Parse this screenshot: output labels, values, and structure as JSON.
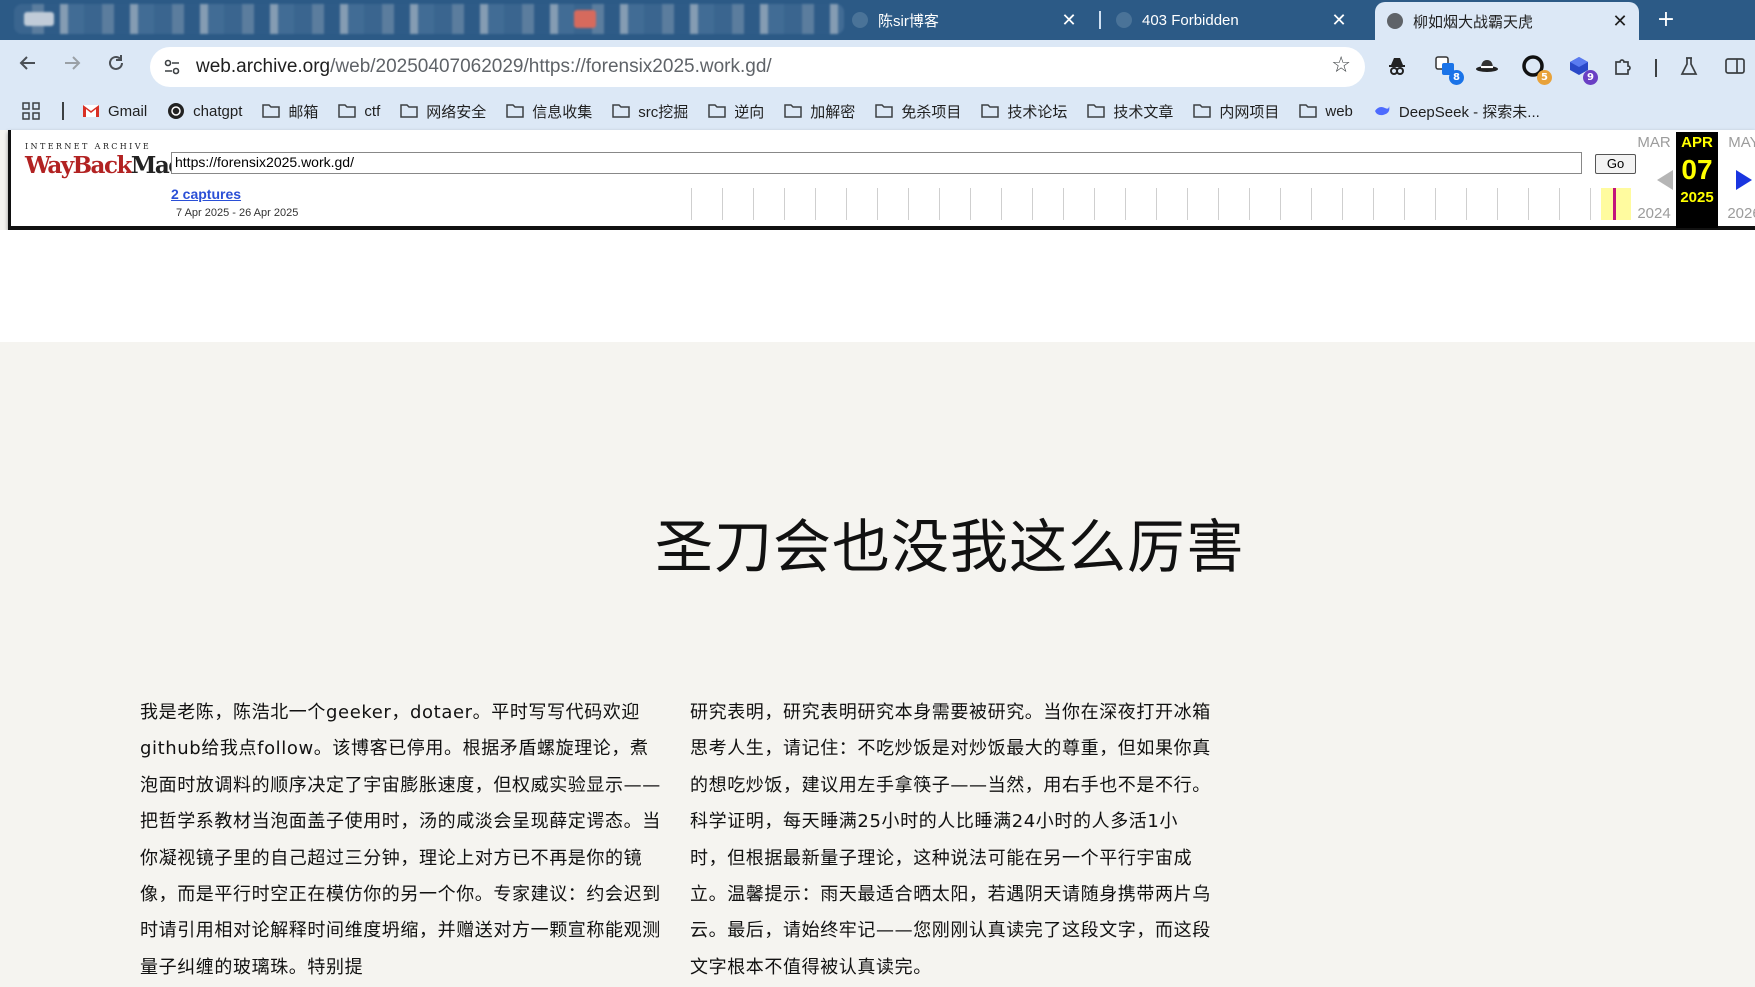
{
  "browser": {
    "tabs": [
      {
        "title": "陈sir博客",
        "favicon_color": "#5f7f99"
      },
      {
        "title": "403 Forbidden",
        "favicon_color": "#5f7f99"
      },
      {
        "title": "柳如烟大战霸天虎",
        "favicon_color": "#5f6368",
        "active": true
      }
    ],
    "new_tab_label": "+",
    "close_label": "✕",
    "url_host": "web.archive.org",
    "url_path": "/web/20250407062029/https://forensix2025.work.gd/",
    "extensions": [
      {
        "name": "incognito-extension-icon"
      },
      {
        "name": "translate-extension-icon",
        "badge": "8",
        "badge_color": "#1a73e8"
      },
      {
        "name": "hat-extension-icon"
      },
      {
        "name": "c-extension-icon",
        "badge": "5",
        "badge_color": "#e8a23a"
      },
      {
        "name": "cube-extension-icon",
        "badge": "9",
        "badge_color": "#6a3fc4"
      },
      {
        "name": "puzzle-extension-icon"
      },
      {
        "name": "flask-icon"
      },
      {
        "name": "sidepanel-icon"
      }
    ],
    "bookmarks": [
      {
        "label": "Gmail",
        "icon": "gmail-icon"
      },
      {
        "label": "chatgpt",
        "icon": "chatgpt-icon"
      },
      {
        "label": "邮箱",
        "icon": "folder-icon"
      },
      {
        "label": "ctf",
        "icon": "folder-icon"
      },
      {
        "label": "网络安全",
        "icon": "folder-icon"
      },
      {
        "label": "信息收集",
        "icon": "folder-icon"
      },
      {
        "label": "src挖掘",
        "icon": "folder-icon"
      },
      {
        "label": "逆向",
        "icon": "folder-icon"
      },
      {
        "label": "加解密",
        "icon": "folder-icon"
      },
      {
        "label": "免杀项目",
        "icon": "folder-icon"
      },
      {
        "label": "技术论坛",
        "icon": "folder-icon"
      },
      {
        "label": "技术文章",
        "icon": "folder-icon"
      },
      {
        "label": "内网项目",
        "icon": "folder-icon"
      },
      {
        "label": "web",
        "icon": "folder-icon"
      },
      {
        "label": "DeepSeek - 探索未...",
        "icon": "deepseek-icon"
      }
    ]
  },
  "wayback": {
    "logo_top": "INTERNET ARCHIVE",
    "logo_way": "WayBack",
    "logo_machine": "Machine",
    "url_value": "https://forensix2025.work.gd/",
    "go_label": "Go",
    "captures_label": "2 captures",
    "date_range": "7 Apr 2025 - 26 Apr 2025",
    "prev_month": "MAR",
    "prev_year": "2024",
    "current_month": "APR",
    "current_day": "07",
    "current_year": "2025",
    "next_month": "MAY",
    "next_year": "2026"
  },
  "page": {
    "title": "圣刀会也没我这么厉害",
    "left_column": "我是老陈，陈浩北一个geeker，dotaer。平时写写代码欢迎github给我点follow。该博客已停用。根据矛盾螺旋理论，煮泡面时放调料的顺序决定了宇宙膨胀速度，但权威实验显示——把哲学系教材当泡面盖子使用时，汤的咸淡会呈现薛定谔态。当你凝视镜子里的自己超过三分钟，理论上对方已不再是你的镜像，而是平行时空正在模仿你的另一个你。专家建议：约会迟到时请引用相对论解释时间维度坍缩，并赠送对方一颗宣称能观测量子纠缠的玻璃珠。特别提",
    "right_column": "研究表明，研究表明研究本身需要被研究。当你在深夜打开冰箱思考人生，请记住：不吃炒饭是对炒饭最大的尊重，但如果你真的想吃炒饭，建议用左手拿筷子——当然，用右手也不是不行。科学证明，每天睡满25小时的人比睡满24小时的人多活1小时，但根据最新量子理论，这种说法可能在另一个平行宇宙成立。温馨提示：雨天最适合晒太阳，若遇阴天请随身携带两片乌云。最后，请始终牢记——您刚刚认真读完了这段文字，而这段文字根本不值得被认真读完。"
  }
}
